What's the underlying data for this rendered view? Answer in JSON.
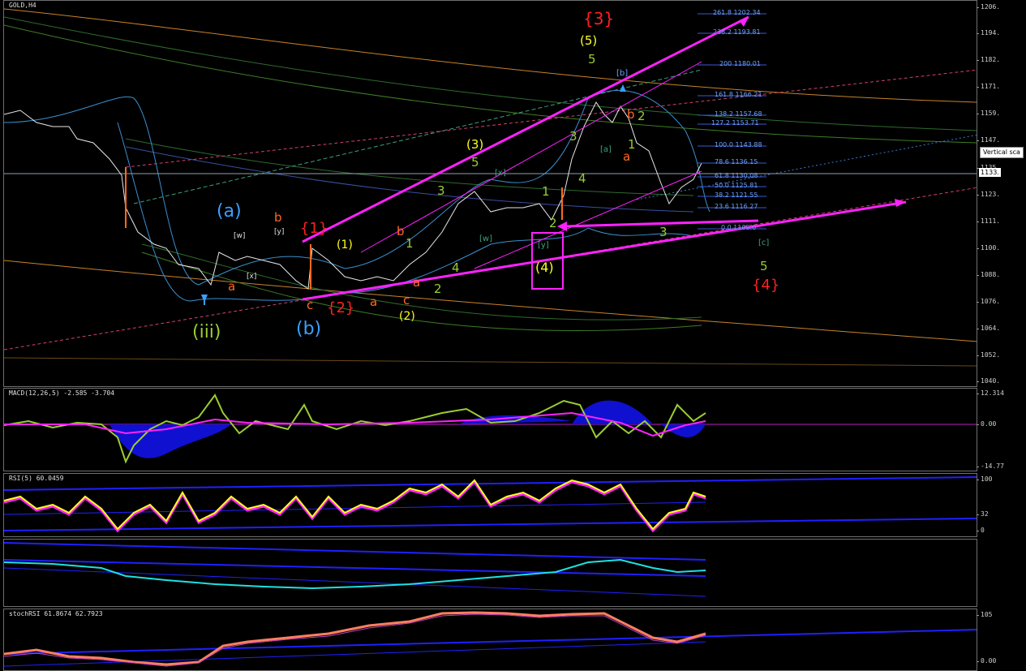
{
  "main": {
    "symbol_label": "GOLD,H4",
    "vertical_scale_tag": "Vertical sca",
    "current_price": "1133.",
    "price_ticks": [
      "1206.",
      "1194.",
      "1182.",
      "1171.",
      "1159.",
      "1147.",
      "1135.",
      "1123.",
      "1111.",
      "1100.",
      "1088.",
      "1076.",
      "1064.",
      "1052.",
      "1040."
    ],
    "fib_levels": [
      "261.8 1202.34",
      "238.2 1193.81",
      "200 1180.01",
      "161.8 1166.21",
      "138.2 1157.68",
      "127.2 1153.71",
      "100.0 1143.88",
      "78.6 1136.15",
      "61.8 1130.08",
      "50.0 1125.81",
      "38.2 1121.55",
      "23.6 1116.27",
      "0.0 1105.0"
    ],
    "wave_labels": {
      "w3_red": "{3}",
      "w5_paren_yellow": "(5)",
      "w5_green_top": "5",
      "a_blue": "(a)",
      "b_blue": "(b)",
      "iii_green": "(iii)",
      "w1_red": "{1}",
      "w2_red": "{2}",
      "w4_red": "{4}",
      "p1_yellow": "(1)",
      "p2_yellow": "(2)",
      "p3_yellow": "(3)",
      "p4_yellow": "(4)",
      "g5_mid": "5",
      "g3": "3",
      "g4": "4",
      "g2": "2",
      "g1": "1",
      "b_orange": "b",
      "a_orange": "a",
      "c_orange": "c",
      "c_orange2": "c",
      "a_orange2": "a",
      "a_orange3": "a",
      "b_orange2": "b",
      "b_box": "[b]",
      "a_box": "[a]",
      "c_box": "[c]",
      "x_box": "[x]",
      "w_box": "[w]",
      "y_box": "[y]",
      "x_box2": "[x]",
      "w_box2": "[w]",
      "y_box2": "[y]",
      "g5_right": "5",
      "g3_right": "3",
      "g2_right": "2",
      "g1_right": "1",
      "g3_right2": "3",
      "a_red_right": "a",
      "b_red_right": "b",
      "g1_mid": "1",
      "g2_mid": "2",
      "g3_mid": "3",
      "g4_mid": "4"
    }
  },
  "macd": {
    "label": "MACD(12,26,5) -2.585 -3.704",
    "ticks": [
      "12.314",
      "0.00",
      "-14.77"
    ]
  },
  "rsi": {
    "label": "RSI(5) 60.0459",
    "ticks": [
      "100",
      "32",
      "0"
    ]
  },
  "pane3": {
    "ticks": []
  },
  "stoch": {
    "label": "stochRSI 61.8674 62.7923",
    "ticks": [
      "105",
      "0.00"
    ]
  },
  "colors": {
    "magenta": "#ff22ff",
    "red": "#ff2020",
    "yellow": "#ffff20",
    "green": "#9acd32",
    "blue_label": "#3aa0ff",
    "orange": "#ff6a20"
  }
}
